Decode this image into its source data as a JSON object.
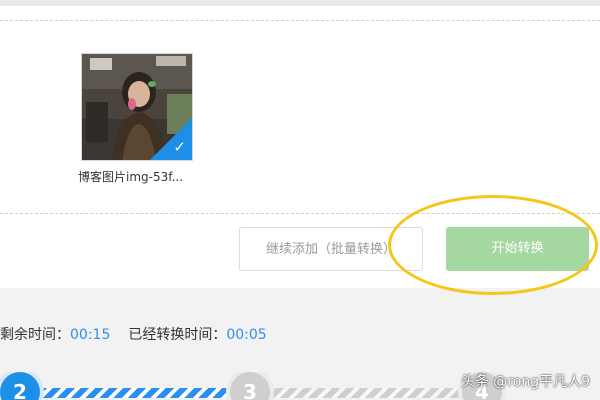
{
  "upload": {
    "thumbnail_label": "博客图片img-53f...",
    "selected": true
  },
  "actions": {
    "add_more_label": "继续添加（批量转换）",
    "start_label": "开始转换"
  },
  "timing": {
    "remaining_label": "剩余时间：",
    "remaining_value": "00:15",
    "elapsed_label": "已经转换时间：",
    "elapsed_value": "00:05"
  },
  "steps": {
    "current": "2",
    "next": "3",
    "last": "4"
  },
  "watermark": "头条 @rong平凡人9",
  "colors": {
    "accent": "#1e8fe6",
    "start_button": "#a5d8a0",
    "highlight": "#f5c518"
  }
}
